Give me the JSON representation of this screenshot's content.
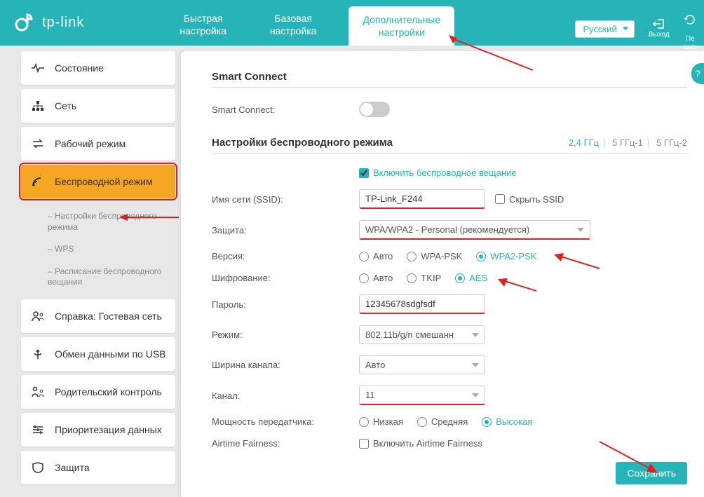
{
  "brand": "tp-link",
  "header": {
    "tab_quick": "Быстрая\nнастройка",
    "tab_basic": "Базовая\nнастройка",
    "tab_adv": "Дополнительные\nнастройки",
    "language": "Русский",
    "logout": "Выход",
    "reboot": "Пе\nзагр"
  },
  "sidebar": {
    "status": "Состояние",
    "network": "Сеть",
    "opmode": "Рабочий режим",
    "wireless": "Беспроводной режим",
    "sub_settings": "Настройки беспроводного режима",
    "sub_wps": "WPS",
    "sub_schedule": "Расписание беспроводного вещания",
    "guest": "Справка: Гостевая сеть",
    "usb": "Обмен данными по USB",
    "parental": "Родительский контроль",
    "qos": "Приоритезация данных",
    "security": "Защита"
  },
  "smart": {
    "title": "Smart Connect",
    "label": "Smart Connect:"
  },
  "wifi": {
    "title": "Настройки беспроводного режима",
    "band24": "2,4 ГГц",
    "band51": "5 ГГц-1",
    "band52": "5 ГГц-2",
    "enable": "Включить беспроводное вещание",
    "ssid_label": "Имя сети (SSID):",
    "ssid_value": "TP-Link_F244",
    "hide_ssid": "Скрыть SSID",
    "security_label": "Защита:",
    "security_value": "WPA/WPA2 - Personal (рекомендуется)",
    "version_label": "Версия:",
    "v_auto": "Авто",
    "v_wpa": "WPA-PSK",
    "v_wpa2": "WPA2-PSK",
    "enc_label": "Шифрование:",
    "e_auto": "Авто",
    "e_tkip": "TKIP",
    "e_aes": "AES",
    "pwd_label": "Пароль:",
    "pwd_value": "12345678sdgfsdf",
    "mode_label": "Режим:",
    "mode_value": "802.11b/g/n смешанн",
    "width_label": "Ширина канала:",
    "width_value": "Авто",
    "channel_label": "Канал:",
    "channel_value": "11",
    "power_label": "Мощность передатчика:",
    "p_low": "Низкая",
    "p_med": "Средняя",
    "p_high": "Высокая",
    "atf_label": "Airtime Fairness:",
    "atf_check": "Включить Airtime Fairness"
  },
  "save": "Сохранить"
}
